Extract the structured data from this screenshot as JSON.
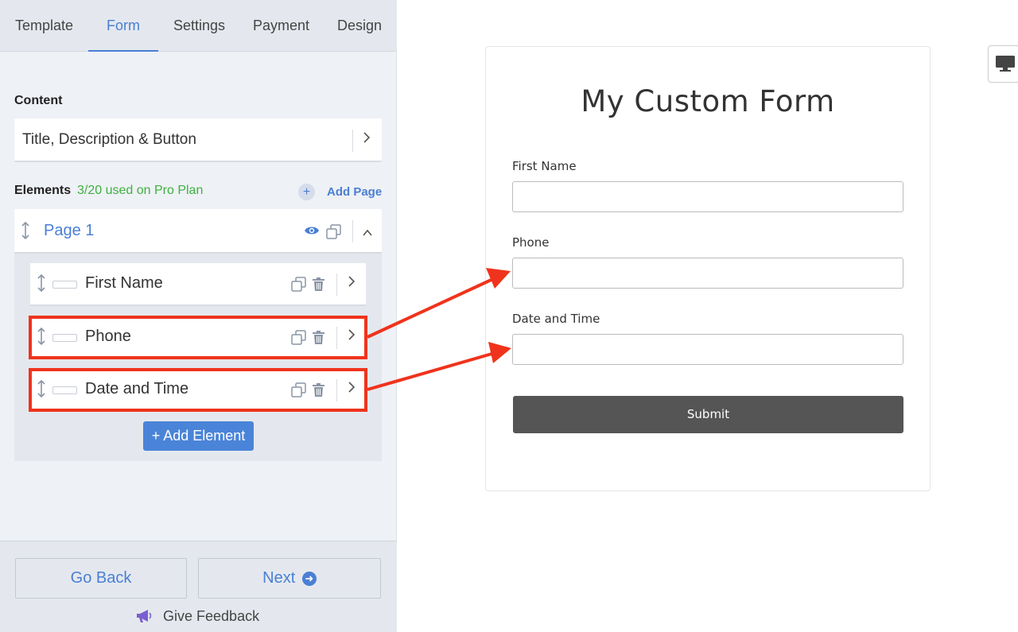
{
  "tabs": [
    "Template",
    "Form",
    "Settings",
    "Payment",
    "Design"
  ],
  "active_tab": "Form",
  "content": {
    "label": "Content",
    "row_text": "Title, Description & Button"
  },
  "elements": {
    "label": "Elements",
    "usage": "3/20 used on Pro Plan",
    "add_page": "Add Page",
    "page_title": "Page 1",
    "items": [
      {
        "label": "First Name"
      },
      {
        "label": "Phone"
      },
      {
        "label": "Date and Time"
      }
    ],
    "add_element": "+ Add Element"
  },
  "footer": {
    "go_back": "Go Back",
    "next": "Next",
    "feedback": "Give Feedback"
  },
  "preview": {
    "title": "My Custom Form",
    "fields": [
      {
        "label": "First Name",
        "value": ""
      },
      {
        "label": "Phone",
        "value": ""
      },
      {
        "label": "Date and Time",
        "value": ""
      }
    ],
    "submit": "Submit"
  },
  "colors": {
    "accent": "#4a7fd4",
    "usage_green": "#3fb03f",
    "highlight": "#f0331c",
    "submit_bg": "#555555"
  },
  "icons": [
    "drag-handle-icon",
    "eye-icon",
    "duplicate-icon",
    "trash-icon",
    "chevron-right-icon",
    "chevron-up-icon",
    "megaphone-icon",
    "desktop-icon",
    "arrow-circle-right-icon"
  ]
}
